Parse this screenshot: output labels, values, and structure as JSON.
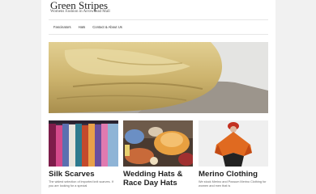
{
  "site": {
    "title": "Green Stripes",
    "description": "Womens Fashion in Arrowhead Mall"
  },
  "nav": {
    "items": [
      "Fascinators",
      "Hats",
      "Contact & About Us"
    ]
  },
  "hero": {
    "image": "straw-fascinator-hat-photo"
  },
  "cards": [
    {
      "title": "Silk Scarves",
      "image": "scarf-rack-photo",
      "text": "The widest selection of imported knit scarves. If you are looking for a special"
    },
    {
      "title": "Wedding Hats & Race Day Hats",
      "image": "hats-display-photo",
      "text": ""
    },
    {
      "title": "Merino Clothing",
      "image": "orange-poncho-photo",
      "text": "We stock Merino and Possum Merino Clothing for women and men that is"
    }
  ],
  "colors": {
    "page_bg": "#f1f1f1",
    "content_bg": "#ffffff",
    "heading": "#222222",
    "body_text": "#666666"
  }
}
